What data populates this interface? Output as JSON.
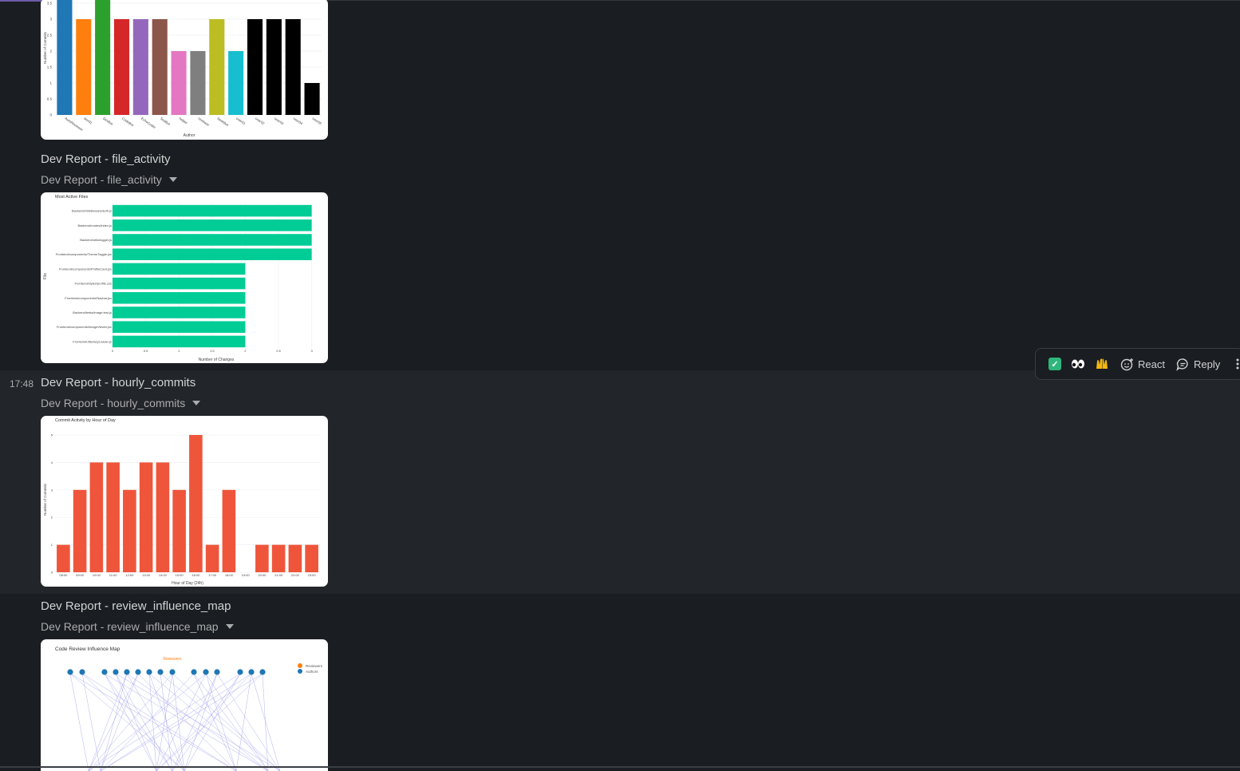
{
  "timestamp": "17:48",
  "messages": [
    {
      "title": "Dev Report - file_activity",
      "file_label": "Dev Report - file_activity"
    },
    {
      "title": "Dev Report - hourly_commits",
      "file_label": "Dev Report - hourly_commits"
    },
    {
      "title": "Dev Report - review_influence_map",
      "file_label": "Dev Report - review_influence_map"
    }
  ],
  "toolbar": {
    "emojis": [
      "white-check-mark",
      "eyes",
      "raised-hands"
    ],
    "react_label": "React",
    "reply_label": "Reply"
  },
  "chart_data": [
    {
      "type": "bar",
      "title": "",
      "xlabel": "Author",
      "ylabel": "Number of Commits",
      "ylim": [
        0,
        3.5
      ],
      "yticks": [
        "0",
        "0.5",
        "1",
        "1.5",
        "2",
        "2.5",
        "3",
        "3.5"
      ],
      "categories": [
        "AutoReviewer",
        "dev01",
        "DevBot",
        "CodeBot",
        "EchoCoder",
        "TestBot",
        "helper",
        "reviewer",
        "SeekBot",
        "user01",
        "user02",
        "user03",
        "user04",
        "user05"
      ],
      "values": [
        3.6,
        3,
        3.6,
        3,
        3,
        3,
        2,
        2,
        3,
        2,
        3,
        3,
        3,
        1
      ],
      "colors": [
        "#1f77b4",
        "#ff7f0e",
        "#2ca02c",
        "#d62728",
        "#9467bd",
        "#8c564b",
        "#e377c2",
        "#7f7f7f",
        "#bcbd22",
        "#17becf",
        "#000000",
        "#000000",
        "#000000",
        "#000000"
      ]
    },
    {
      "type": "bar",
      "orientation": "horizontal",
      "title": "Most Active Files",
      "xlabel": "Number of Changes",
      "ylabel": "File",
      "xlim": [
        0,
        3
      ],
      "xticks": [
        "0",
        "0.5",
        "1",
        "1.5",
        "2",
        "2.5",
        "3"
      ],
      "categories": [
        "Backend/middleware/auth.js",
        "Backend/routes/index.js",
        "Backend/utils/logger.js",
        "Frontend/components/ThemeToggle.jsx",
        "Frontend/components/ProfileCard.jsx",
        "Frontend/styles/profile.css",
        "Frontend/components/Navbar.jsx",
        "Backend/tests/image.test.js",
        "Frontend/components/ImageViewer.jsx",
        "Frontend/utils/lazyLoader.js"
      ],
      "values": [
        3,
        3,
        3,
        3,
        2,
        2,
        2,
        2,
        2,
        2
      ],
      "color": "#00cc96"
    },
    {
      "type": "bar",
      "title": "Commit Activity by Hour of Day",
      "xlabel": "Hour of Day (24h)",
      "ylabel": "Number of Commits",
      "ylim": [
        0,
        5
      ],
      "yticks": [
        "0",
        "1",
        "2",
        "3",
        "4",
        "5"
      ],
      "categories": [
        "08:00",
        "09:00",
        "10:00",
        "11:00",
        "12:00",
        "13:00",
        "14:00",
        "15:00",
        "16:00",
        "17:00",
        "18:00",
        "19:00",
        "20:00",
        "21:00",
        "22:00",
        "23:00"
      ],
      "values": [
        1,
        3,
        4,
        4,
        3,
        4,
        4,
        3,
        5,
        1,
        3,
        0,
        1,
        1,
        1,
        1
      ],
      "color": "#ef553b"
    },
    {
      "type": "diagram",
      "title": "Code Review Influence Map",
      "subtitle": "Reviewers",
      "legend": [
        "Reviewers",
        "Authors"
      ],
      "legend_colors": [
        "#ff7f0e",
        "#1f77b4"
      ],
      "top_nodes": 17
    }
  ]
}
